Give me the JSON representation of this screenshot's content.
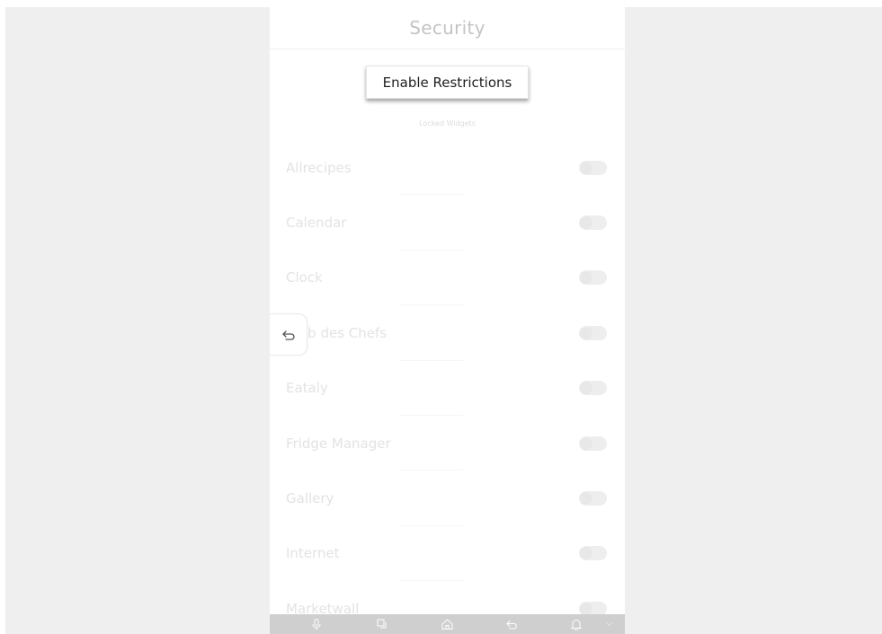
{
  "header": {
    "title": "Security"
  },
  "restrictions": {
    "button_label": "Enable Restrictions"
  },
  "section": {
    "label": "Locked Widgets"
  },
  "widgets": [
    {
      "name": "Allrecipes",
      "locked": false
    },
    {
      "name": "Calendar",
      "locked": false
    },
    {
      "name": "Clock",
      "locked": false
    },
    {
      "name": "Club des Chefs",
      "locked": false
    },
    {
      "name": "Eataly",
      "locked": false
    },
    {
      "name": "Fridge Manager",
      "locked": false
    },
    {
      "name": "Gallery",
      "locked": false
    },
    {
      "name": "Internet",
      "locked": false
    },
    {
      "name": "Marketwall",
      "locked": false
    }
  ],
  "navbar": {
    "icons": [
      "microphone-icon",
      "recent-apps-icon",
      "home-icon",
      "back-icon",
      "notification-bell-icon",
      "chevron-down-icon"
    ]
  },
  "colors": {
    "panel_bg": "#ffffff",
    "backdrop": "#efefef",
    "navbar": "#cfcfcf",
    "faded_text": "#e3e3e3"
  }
}
